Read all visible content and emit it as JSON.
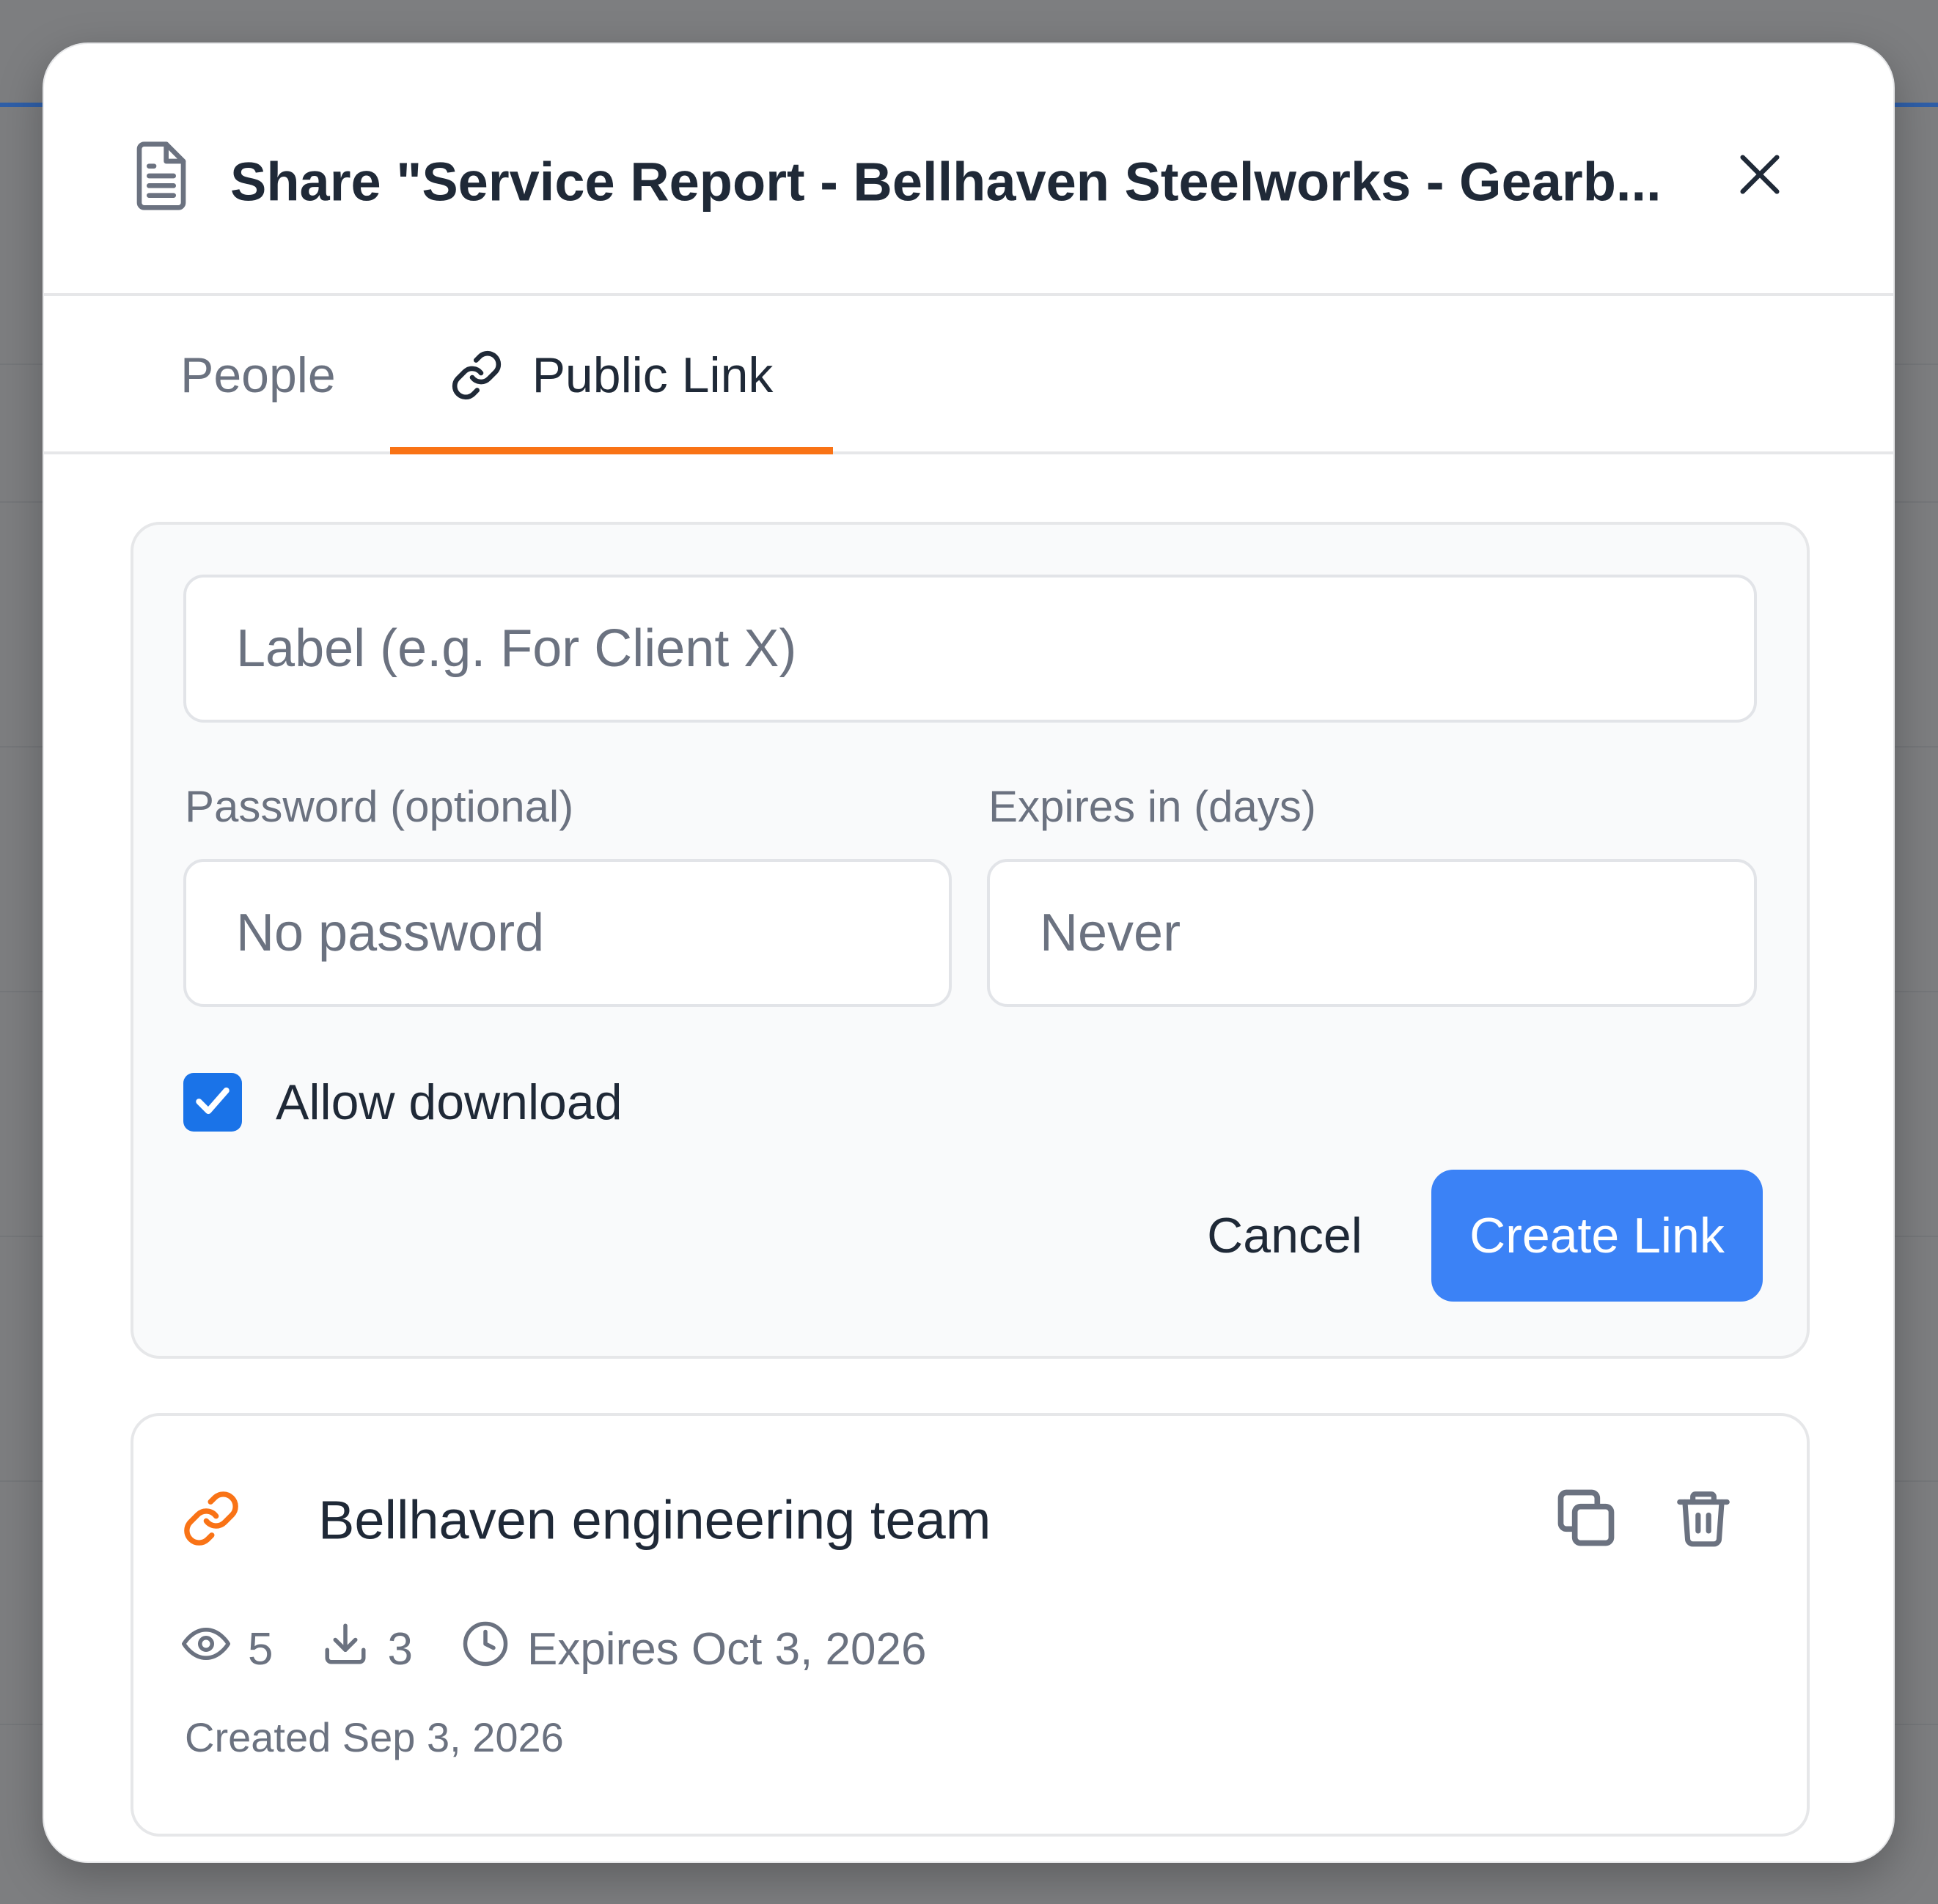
{
  "dialog": {
    "title": "Share \"Service Report - Bellhaven Steelworks - Gearb...",
    "icons": {
      "document": "document-icon",
      "close": "close-icon"
    }
  },
  "tabs": [
    {
      "label": "People",
      "active": false
    },
    {
      "label": "Public Link",
      "active": true,
      "icon": "link-icon"
    }
  ],
  "colors": {
    "accent_tab": "#f97316",
    "primary_button": "#3b82f6",
    "checkbox": "#1a73e8",
    "link_icon": "#f97316"
  },
  "form": {
    "label_input": {
      "placeholder": "Label (e.g. For Client X)",
      "value": ""
    },
    "password": {
      "label": "Password (optional)",
      "placeholder": "No password",
      "value": ""
    },
    "expires": {
      "label": "Expires in (days)",
      "placeholder": "Never",
      "value": ""
    },
    "allow_download": {
      "label": "Allow download",
      "checked": true
    },
    "cancel_label": "Cancel",
    "create_label": "Create Link"
  },
  "links": [
    {
      "name": "Bellhaven engineering team",
      "views": "5",
      "downloads": "3",
      "expires": "Expires Oct 3, 2026",
      "created": "Created Sep 3, 2026",
      "icons": [
        "link-icon",
        "copy-icon",
        "trash-icon",
        "eye-icon",
        "download-icon",
        "clock-icon"
      ]
    }
  ]
}
